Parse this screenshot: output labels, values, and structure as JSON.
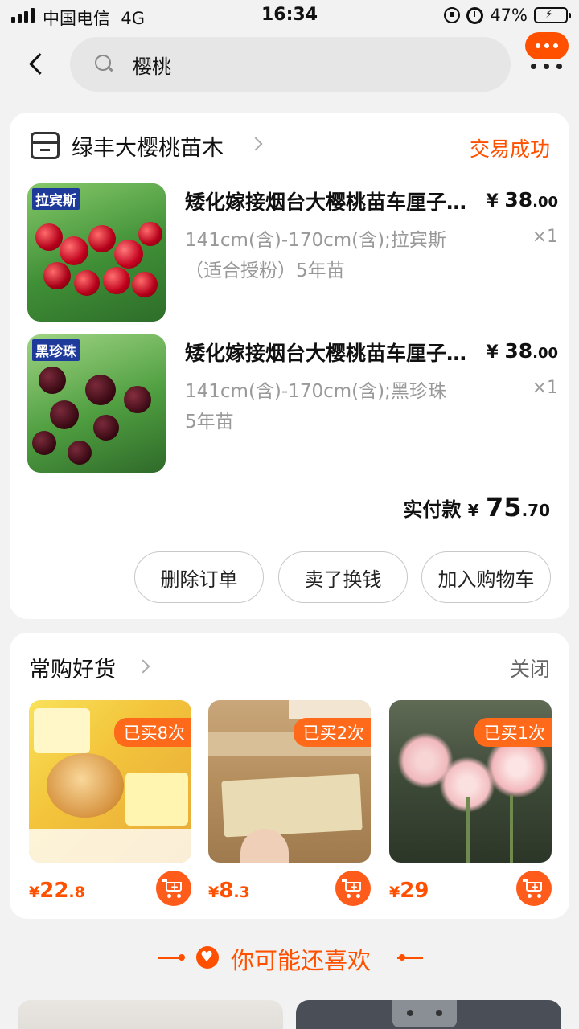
{
  "status_bar": {
    "carrier": "中国电信",
    "network": "4G",
    "time": "16:34",
    "battery": "47%",
    "battery_level": 0.47
  },
  "search": {
    "value": "樱桃"
  },
  "order": {
    "shop_name": "绿丰大樱桃苗木",
    "status": "交易成功",
    "items": [
      {
        "tag": "拉宾斯",
        "title": "矮化嫁接烟台大樱桃苗车厘子树苗",
        "price_main": "38",
        "price_cents": ".00",
        "currency": "¥",
        "sku_line1": "141cm(含)-170cm(含);拉宾斯",
        "sku_line2": "（适合授粉）5年苗",
        "qty": "×1"
      },
      {
        "tag": "黑珍珠",
        "title": "矮化嫁接烟台大樱桃苗车厘子树苗",
        "price_main": "38",
        "price_cents": ".00",
        "currency": "¥",
        "sku_line1": "141cm(含)-170cm(含);黑珍珠",
        "sku_line2": "5年苗",
        "qty": "×1"
      }
    ],
    "total_label": "实付款",
    "total_currency": "¥",
    "total_main": "75",
    "total_cents": ".70",
    "buttons": {
      "delete": "删除订单",
      "resell": "卖了换钱",
      "add_cart": "加入购物车"
    }
  },
  "frequent": {
    "title": "常购好货",
    "close": "关闭",
    "products": [
      {
        "bought": "已买8次",
        "currency": "¥",
        "price_main": "22",
        "price_decimal": ".8"
      },
      {
        "bought": "已买2次",
        "currency": "¥",
        "price_main": "8",
        "price_decimal": ".3"
      },
      {
        "bought": "已买1次",
        "currency": "¥",
        "price_main": "29",
        "price_decimal": ""
      }
    ]
  },
  "recommend": {
    "title": "你可能还喜欢"
  }
}
